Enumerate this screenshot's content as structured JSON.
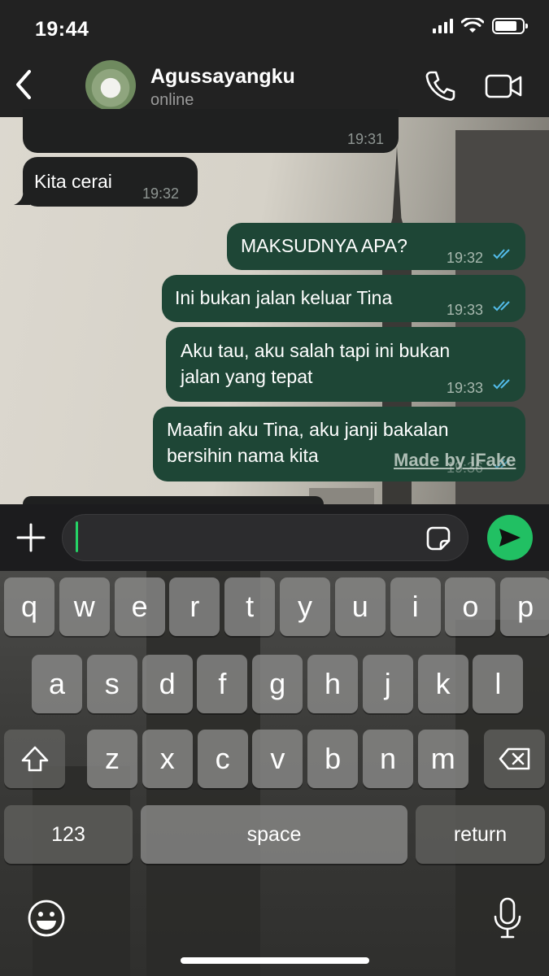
{
  "status_bar": {
    "time": "19:44"
  },
  "header": {
    "contact_name": "Agussayangku",
    "contact_status": "online"
  },
  "messages": [
    {
      "direction": "in",
      "text": "",
      "time": "19:31"
    },
    {
      "direction": "in",
      "text": "Kita cerai",
      "time": "19:32"
    },
    {
      "direction": "out",
      "text": "MAKSUDNYA APA?",
      "time": "19:32",
      "read": true
    },
    {
      "direction": "out",
      "text": "Ini bukan jalan keluar Tina",
      "time": "19:33",
      "read": true
    },
    {
      "direction": "out",
      "line1": "Aku tau, aku salah tapi ini bukan",
      "line2": "jalan yang tepat",
      "time": "19:33",
      "read": true
    },
    {
      "direction": "out",
      "line1": "Maafin aku Tina, aku janji bakalan",
      "line2": "bersihin nama kita",
      "time": "19:36",
      "read": true
    }
  ],
  "watermark": "Made by iFake",
  "input": {
    "value": ""
  },
  "keyboard": {
    "row1": [
      "q",
      "w",
      "e",
      "r",
      "t",
      "y",
      "u",
      "i",
      "o",
      "p"
    ],
    "row2": [
      "a",
      "s",
      "d",
      "f",
      "g",
      "h",
      "j",
      "k",
      "l"
    ],
    "row3": [
      "z",
      "x",
      "c",
      "v",
      "b",
      "n",
      "m"
    ],
    "numbers_key": "123",
    "space_key": "space",
    "return_key": "return"
  },
  "colors": {
    "outgoing_bubble": "#1e4636",
    "incoming_bubble": "#1f2020",
    "send_button": "#21c063",
    "read_ticks": "#53bdeb"
  },
  "icons": [
    "back-icon",
    "phone-icon",
    "video-camera-icon",
    "plus-icon",
    "sticker-icon",
    "send-icon",
    "shift-icon",
    "backspace-icon",
    "emoji-icon",
    "microphone-icon"
  ]
}
